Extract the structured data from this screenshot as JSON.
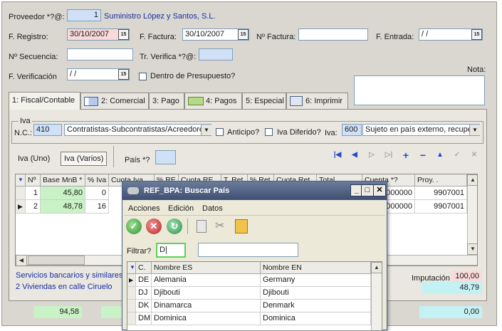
{
  "header": {
    "proveedor_label": "Proveedor *?@:",
    "proveedor_code": "1",
    "proveedor_name": "Suministro López y Santos, S.L.",
    "f_registro_label": "F. Registro:",
    "f_registro_value": "30/10/2007",
    "f_factura_label": "F. Factura:",
    "f_factura_value": "30/10/2007",
    "n_factura_label": "Nº Factura:",
    "n_factura_value": "",
    "f_entrada_label": "F. Entrada:",
    "f_entrada_value": " / /",
    "n_secuencia_label": "Nº Secuencia:",
    "n_secuencia_value": "",
    "tr_verifica_label": "Tr. Verifica *?@:",
    "tr_verifica_value": "",
    "f_verificacion_label": "F. Verificación",
    "f_verificacion_value": " / /",
    "presupuesto_label": "Dentro de Presupuesto?",
    "nota_label": "Nota:",
    "cal_icon": "15"
  },
  "tabs": [
    {
      "label": "1: Fiscal/Contable",
      "icon": ""
    },
    {
      "label": "2: Comercial",
      "icon": "grid-icon"
    },
    {
      "label": "3: Pago",
      "icon": ""
    },
    {
      "label": "4: Pagos",
      "icon": "money-icon"
    },
    {
      "label": "5: Especial",
      "icon": ""
    },
    {
      "label": "6: Imprimir",
      "icon": "printer-icon"
    }
  ],
  "iva": {
    "group_label": "Iva",
    "nc_label": "N.C.:",
    "nc_code": "410",
    "nc_desc": "Contratistas-Subcontratistas/Acreedore:",
    "anticipo_label": "Anticipo?",
    "diferido_label": "Iva Diferido?",
    "iva_label": "Iva:",
    "iva_code": "600",
    "iva_desc": "Sujeto en país externo, recupe",
    "btn_uno": "Iva (Uno)",
    "btn_varios": "Iva (Varios)",
    "pais_label": "País *?",
    "pais_value": ""
  },
  "grid": {
    "columns": [
      "Nº",
      "Base MnB *",
      "% Iva",
      "Cuota Iva",
      "% RE",
      "Cuota RE",
      "T. Ret",
      "% Ret",
      "Cuota Ret",
      "Total",
      "Cuenta *?",
      "Proy. ."
    ],
    "rows": [
      {
        "n": "1",
        "base": "45,80",
        "pct_iva": "0",
        "cuenta": "000000",
        "proy": "9907001"
      },
      {
        "n": "2",
        "base": "48,78",
        "pct_iva": "16",
        "cuenta": "000000",
        "proy": "9907001"
      }
    ]
  },
  "footer": {
    "line1": "Servicios bancarios y similares.",
    "line2": "2 Viviendas en calle Ciruelo",
    "imputacion_label": "Imputación",
    "imputacion_value": "100,00",
    "imputacion_total": "48,79",
    "total_base": "94,58",
    "total_right": "0,00"
  },
  "dialog": {
    "title": "REF_BPA: Buscar País",
    "menu": [
      "Acciones",
      "Edición",
      "Datos"
    ],
    "filter_label": "Filtrar?",
    "filter_value": "D|",
    "filter_second_value": "",
    "columns": [
      "C.",
      "Nombre ES",
      "Nombre EN"
    ],
    "rows": [
      {
        "code": "DE",
        "es": "Alemania",
        "en": "Germany"
      },
      {
        "code": "DJ",
        "es": "Djibouti",
        "en": "Djibouti"
      },
      {
        "code": "DK",
        "es": "Dinamarca",
        "en": "Denmark"
      },
      {
        "code": "DM",
        "es": "Dominica",
        "en": "Dominica"
      }
    ]
  }
}
